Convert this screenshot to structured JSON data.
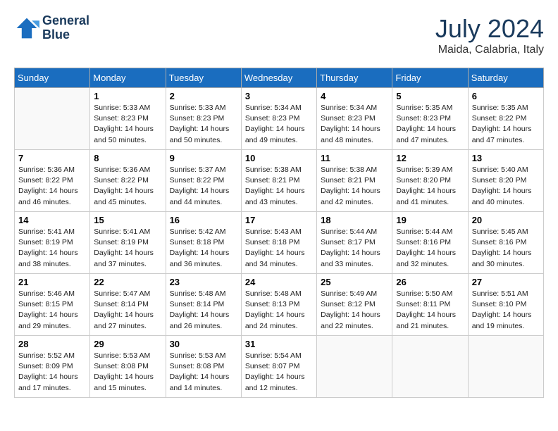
{
  "header": {
    "logo_line1": "General",
    "logo_line2": "Blue",
    "month_year": "July 2024",
    "location": "Maida, Calabria, Italy"
  },
  "days_of_week": [
    "Sunday",
    "Monday",
    "Tuesday",
    "Wednesday",
    "Thursday",
    "Friday",
    "Saturday"
  ],
  "weeks": [
    [
      {
        "day": null,
        "info": null
      },
      {
        "day": "1",
        "info": "Sunrise: 5:33 AM\nSunset: 8:23 PM\nDaylight: 14 hours\nand 50 minutes."
      },
      {
        "day": "2",
        "info": "Sunrise: 5:33 AM\nSunset: 8:23 PM\nDaylight: 14 hours\nand 50 minutes."
      },
      {
        "day": "3",
        "info": "Sunrise: 5:34 AM\nSunset: 8:23 PM\nDaylight: 14 hours\nand 49 minutes."
      },
      {
        "day": "4",
        "info": "Sunrise: 5:34 AM\nSunset: 8:23 PM\nDaylight: 14 hours\nand 48 minutes."
      },
      {
        "day": "5",
        "info": "Sunrise: 5:35 AM\nSunset: 8:23 PM\nDaylight: 14 hours\nand 47 minutes."
      },
      {
        "day": "6",
        "info": "Sunrise: 5:35 AM\nSunset: 8:22 PM\nDaylight: 14 hours\nand 47 minutes."
      }
    ],
    [
      {
        "day": "7",
        "info": "Sunrise: 5:36 AM\nSunset: 8:22 PM\nDaylight: 14 hours\nand 46 minutes."
      },
      {
        "day": "8",
        "info": "Sunrise: 5:36 AM\nSunset: 8:22 PM\nDaylight: 14 hours\nand 45 minutes."
      },
      {
        "day": "9",
        "info": "Sunrise: 5:37 AM\nSunset: 8:22 PM\nDaylight: 14 hours\nand 44 minutes."
      },
      {
        "day": "10",
        "info": "Sunrise: 5:38 AM\nSunset: 8:21 PM\nDaylight: 14 hours\nand 43 minutes."
      },
      {
        "day": "11",
        "info": "Sunrise: 5:38 AM\nSunset: 8:21 PM\nDaylight: 14 hours\nand 42 minutes."
      },
      {
        "day": "12",
        "info": "Sunrise: 5:39 AM\nSunset: 8:20 PM\nDaylight: 14 hours\nand 41 minutes."
      },
      {
        "day": "13",
        "info": "Sunrise: 5:40 AM\nSunset: 8:20 PM\nDaylight: 14 hours\nand 40 minutes."
      }
    ],
    [
      {
        "day": "14",
        "info": "Sunrise: 5:41 AM\nSunset: 8:19 PM\nDaylight: 14 hours\nand 38 minutes."
      },
      {
        "day": "15",
        "info": "Sunrise: 5:41 AM\nSunset: 8:19 PM\nDaylight: 14 hours\nand 37 minutes."
      },
      {
        "day": "16",
        "info": "Sunrise: 5:42 AM\nSunset: 8:18 PM\nDaylight: 14 hours\nand 36 minutes."
      },
      {
        "day": "17",
        "info": "Sunrise: 5:43 AM\nSunset: 8:18 PM\nDaylight: 14 hours\nand 34 minutes."
      },
      {
        "day": "18",
        "info": "Sunrise: 5:44 AM\nSunset: 8:17 PM\nDaylight: 14 hours\nand 33 minutes."
      },
      {
        "day": "19",
        "info": "Sunrise: 5:44 AM\nSunset: 8:16 PM\nDaylight: 14 hours\nand 32 minutes."
      },
      {
        "day": "20",
        "info": "Sunrise: 5:45 AM\nSunset: 8:16 PM\nDaylight: 14 hours\nand 30 minutes."
      }
    ],
    [
      {
        "day": "21",
        "info": "Sunrise: 5:46 AM\nSunset: 8:15 PM\nDaylight: 14 hours\nand 29 minutes."
      },
      {
        "day": "22",
        "info": "Sunrise: 5:47 AM\nSunset: 8:14 PM\nDaylight: 14 hours\nand 27 minutes."
      },
      {
        "day": "23",
        "info": "Sunrise: 5:48 AM\nSunset: 8:14 PM\nDaylight: 14 hours\nand 26 minutes."
      },
      {
        "day": "24",
        "info": "Sunrise: 5:48 AM\nSunset: 8:13 PM\nDaylight: 14 hours\nand 24 minutes."
      },
      {
        "day": "25",
        "info": "Sunrise: 5:49 AM\nSunset: 8:12 PM\nDaylight: 14 hours\nand 22 minutes."
      },
      {
        "day": "26",
        "info": "Sunrise: 5:50 AM\nSunset: 8:11 PM\nDaylight: 14 hours\nand 21 minutes."
      },
      {
        "day": "27",
        "info": "Sunrise: 5:51 AM\nSunset: 8:10 PM\nDaylight: 14 hours\nand 19 minutes."
      }
    ],
    [
      {
        "day": "28",
        "info": "Sunrise: 5:52 AM\nSunset: 8:09 PM\nDaylight: 14 hours\nand 17 minutes."
      },
      {
        "day": "29",
        "info": "Sunrise: 5:53 AM\nSunset: 8:08 PM\nDaylight: 14 hours\nand 15 minutes."
      },
      {
        "day": "30",
        "info": "Sunrise: 5:53 AM\nSunset: 8:08 PM\nDaylight: 14 hours\nand 14 minutes."
      },
      {
        "day": "31",
        "info": "Sunrise: 5:54 AM\nSunset: 8:07 PM\nDaylight: 14 hours\nand 12 minutes."
      },
      {
        "day": null,
        "info": null
      },
      {
        "day": null,
        "info": null
      },
      {
        "day": null,
        "info": null
      }
    ]
  ]
}
